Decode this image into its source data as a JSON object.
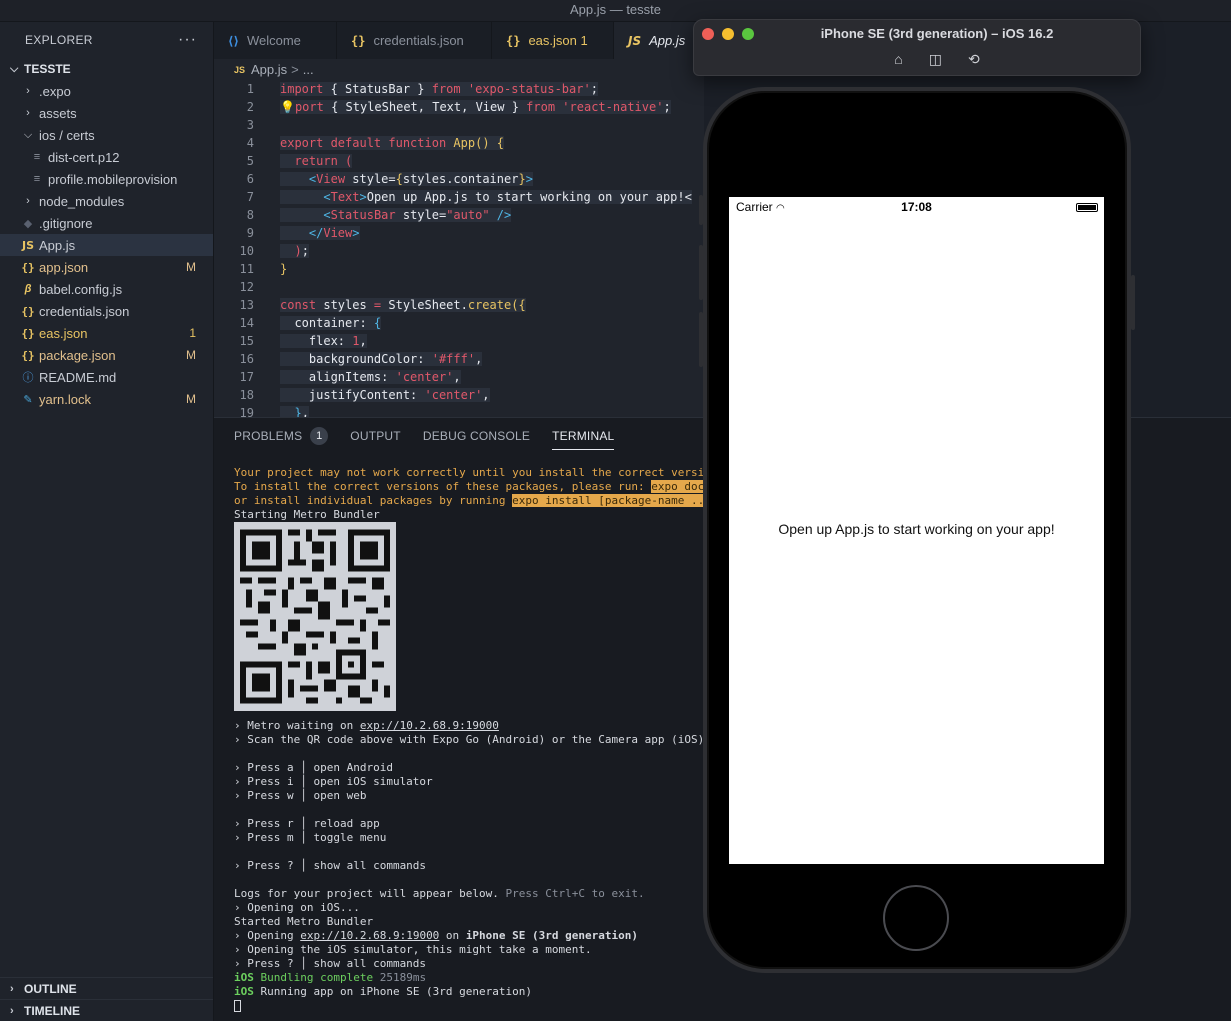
{
  "window_title": "App.js — tesste",
  "explorer": {
    "header": "EXPLORER",
    "more": "···",
    "project": "TESSTE",
    "items": [
      {
        "label": ".expo",
        "kind": "folder-closed"
      },
      {
        "label": "assets",
        "kind": "folder-closed"
      },
      {
        "label": "ios / certs",
        "kind": "folder-open"
      },
      {
        "label": "dist-cert.p12",
        "kind": "file-lines"
      },
      {
        "label": "profile.mobileprovision",
        "kind": "file-lines"
      },
      {
        "label": "node_modules",
        "kind": "folder-closed"
      },
      {
        "label": ".gitignore",
        "kind": "gear"
      },
      {
        "label": "App.js",
        "kind": "js",
        "selected": true
      },
      {
        "label": "app.json",
        "kind": "json",
        "badge": "M"
      },
      {
        "label": "babel.config.js",
        "kind": "babel"
      },
      {
        "label": "credentials.json",
        "kind": "json"
      },
      {
        "label": "eas.json",
        "kind": "json",
        "badge": "1"
      },
      {
        "label": "package.json",
        "kind": "json",
        "badge": "M"
      },
      {
        "label": "README.md",
        "kind": "info"
      },
      {
        "label": "yarn.lock",
        "kind": "yarn",
        "badge": "M"
      }
    ],
    "outline": "OUTLINE",
    "timeline": "TIMELINE"
  },
  "tabs": [
    {
      "label": "Welcome",
      "icon": "VS"
    },
    {
      "label": "credentials.json",
      "icon": "{}"
    },
    {
      "label": "eas.json 1",
      "icon": "{}"
    },
    {
      "label": "App.js",
      "icon": "JS"
    }
  ],
  "breadcrumb": {
    "file": "App.js",
    "sep": ">",
    "rest": "..."
  },
  "code": {
    "line_numbers": [
      "1",
      "2",
      "3",
      "4",
      "5",
      "6",
      "7",
      "8",
      "9",
      "10",
      "11",
      "12",
      "13",
      "14",
      "15",
      "16",
      "17",
      "18",
      "19"
    ]
  },
  "panel": {
    "problems": "PROBLEMS",
    "problems_count": "1",
    "output": "OUTPUT",
    "debug": "DEBUG CONSOLE",
    "terminal": "TERMINAL"
  },
  "terminal": {
    "warn1": "Your project may not work correctly until you install the correct versions of",
    "warn2a": "To install the correct versions of these packages, please run: ",
    "warn2b": "expo doctor --f",
    "warn3a": "or install individual packages by running ",
    "warn3b": "expo install [package-name ...]",
    "starting": "Starting Metro Bundler",
    "metro_waiting_a": "› Metro waiting on ",
    "metro_url": "exp://10.2.68.9:19000",
    "scan": "› Scan the QR code above with Expo Go (Android) or the Camera app (iOS)",
    "press_a": "› Press a │ open Android",
    "press_i": "› Press i │ open iOS simulator",
    "press_w": "› Press w │ open web",
    "press_r": "› Press r │ reload app",
    "press_m": "› Press m │ toggle menu",
    "press_q": "› Press ? │ show all commands",
    "logs_a": "Logs for your project will appear below. ",
    "logs_b": "Press Ctrl+C to exit.",
    "opening_ios": "› Opening on iOS...",
    "started": "Started Metro Bundler",
    "opening_a": "› Opening ",
    "opening_url": "exp://10.2.68.9:19000",
    "opening_b": " on ",
    "opening_device": "iPhone SE (3rd generation)",
    "sim_opening": "› Opening the iOS simulator, this might take a moment.",
    "press_q2": "› Press ? │ show all commands",
    "bundle_ios": "iOS",
    "bundle_text": " Bundling complete ",
    "bundle_ms": "25189ms",
    "run_ios": "iOS",
    "run_text": " Running app on iPhone SE (3rd generation)"
  },
  "simulator": {
    "title": "iPhone SE (3rd generation) – iOS 16.2",
    "carrier": "Carrier",
    "time": "17:08",
    "app_text": "Open up App.js to start working on your app!"
  },
  "colors": {
    "accent_keyword": "#e0586a",
    "function": "#e8c463",
    "warning": "#e5a84b",
    "success": "#6ccf5e"
  }
}
